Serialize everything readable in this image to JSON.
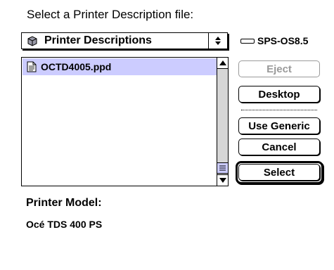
{
  "dialog": {
    "prompt": "Select a Printer Description file:"
  },
  "folder_popup": {
    "label": "Printer Descriptions",
    "icon": "folder-icon"
  },
  "volume": {
    "label": "SPS-OS8.5",
    "icon": "disk-icon"
  },
  "file_list": {
    "items": [
      {
        "name": "OCTD4005.ppd",
        "selected": true,
        "icon": "document-icon"
      }
    ]
  },
  "buttons": {
    "eject": "Eject",
    "desktop": "Desktop",
    "use_generic": "Use Generic",
    "cancel": "Cancel",
    "select": "Select"
  },
  "printer_model": {
    "label": "Printer Model:",
    "value": "Océ TDS 400 PS"
  },
  "colors": {
    "selection": "#ccccff",
    "disabled_text": "#9a9a9a",
    "scroll_track": "#d6d6d6"
  }
}
